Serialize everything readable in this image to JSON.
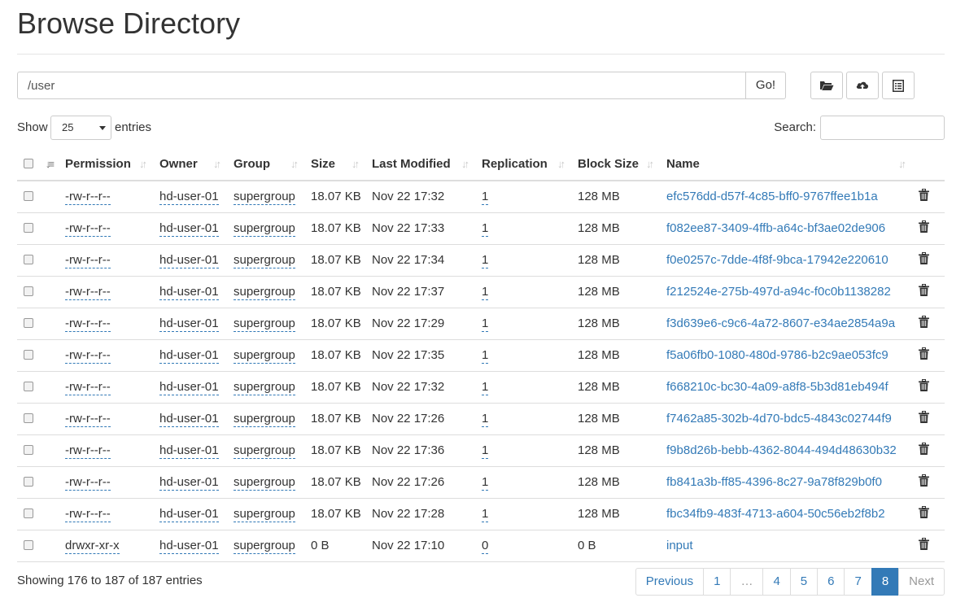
{
  "page_title": "Browse Directory",
  "path": {
    "value": "/user",
    "go_label": "Go!"
  },
  "toolbar": {
    "icons": [
      "folder-open-icon",
      "upload-cloud-icon",
      "list-icon"
    ]
  },
  "controls": {
    "show_label": "Show",
    "entries_value": "25",
    "entries_label": "entries",
    "search_label": "Search:",
    "search_value": ""
  },
  "columns": [
    "Permission",
    "Owner",
    "Group",
    "Size",
    "Last Modified",
    "Replication",
    "Block Size",
    "Name"
  ],
  "rows": [
    {
      "permission": "-rw-r--r--",
      "owner": "hd-user-01",
      "group": "supergroup",
      "size": "18.07 KB",
      "modified": "Nov 22 17:32",
      "replication": "1",
      "block_size": "128 MB",
      "name": "efc576dd-d57f-4c85-bff0-9767ffee1b1a"
    },
    {
      "permission": "-rw-r--r--",
      "owner": "hd-user-01",
      "group": "supergroup",
      "size": "18.07 KB",
      "modified": "Nov 22 17:33",
      "replication": "1",
      "block_size": "128 MB",
      "name": "f082ee87-3409-4ffb-a64c-bf3ae02de906"
    },
    {
      "permission": "-rw-r--r--",
      "owner": "hd-user-01",
      "group": "supergroup",
      "size": "18.07 KB",
      "modified": "Nov 22 17:34",
      "replication": "1",
      "block_size": "128 MB",
      "name": "f0e0257c-7dde-4f8f-9bca-17942e220610"
    },
    {
      "permission": "-rw-r--r--",
      "owner": "hd-user-01",
      "group": "supergroup",
      "size": "18.07 KB",
      "modified": "Nov 22 17:37",
      "replication": "1",
      "block_size": "128 MB",
      "name": "f212524e-275b-497d-a94c-f0c0b1138282"
    },
    {
      "permission": "-rw-r--r--",
      "owner": "hd-user-01",
      "group": "supergroup",
      "size": "18.07 KB",
      "modified": "Nov 22 17:29",
      "replication": "1",
      "block_size": "128 MB",
      "name": "f3d639e6-c9c6-4a72-8607-e34ae2854a9a"
    },
    {
      "permission": "-rw-r--r--",
      "owner": "hd-user-01",
      "group": "supergroup",
      "size": "18.07 KB",
      "modified": "Nov 22 17:35",
      "replication": "1",
      "block_size": "128 MB",
      "name": "f5a06fb0-1080-480d-9786-b2c9ae053fc9"
    },
    {
      "permission": "-rw-r--r--",
      "owner": "hd-user-01",
      "group": "supergroup",
      "size": "18.07 KB",
      "modified": "Nov 22 17:32",
      "replication": "1",
      "block_size": "128 MB",
      "name": "f668210c-bc30-4a09-a8f8-5b3d81eb494f"
    },
    {
      "permission": "-rw-r--r--",
      "owner": "hd-user-01",
      "group": "supergroup",
      "size": "18.07 KB",
      "modified": "Nov 22 17:26",
      "replication": "1",
      "block_size": "128 MB",
      "name": "f7462a85-302b-4d70-bdc5-4843c02744f9"
    },
    {
      "permission": "-rw-r--r--",
      "owner": "hd-user-01",
      "group": "supergroup",
      "size": "18.07 KB",
      "modified": "Nov 22 17:36",
      "replication": "1",
      "block_size": "128 MB",
      "name": "f9b8d26b-bebb-4362-8044-494d48630b32"
    },
    {
      "permission": "-rw-r--r--",
      "owner": "hd-user-01",
      "group": "supergroup",
      "size": "18.07 KB",
      "modified": "Nov 22 17:26",
      "replication": "1",
      "block_size": "128 MB",
      "name": "fb841a3b-ff85-4396-8c27-9a78f829b0f0"
    },
    {
      "permission": "-rw-r--r--",
      "owner": "hd-user-01",
      "group": "supergroup",
      "size": "18.07 KB",
      "modified": "Nov 22 17:28",
      "replication": "1",
      "block_size": "128 MB",
      "name": "fbc34fb9-483f-4713-a604-50c56eb2f8b2"
    },
    {
      "permission": "drwxr-xr-x",
      "owner": "hd-user-01",
      "group": "supergroup",
      "size": "0 B",
      "modified": "Nov 22 17:10",
      "replication": "0",
      "block_size": "0 B",
      "name": "input"
    }
  ],
  "footer": {
    "info": "Showing 176 to 187 of 187 entries"
  },
  "pagination": {
    "items": [
      {
        "label": "Previous",
        "state": "normal"
      },
      {
        "label": "1",
        "state": "normal"
      },
      {
        "label": "…",
        "state": "ellipsis"
      },
      {
        "label": "4",
        "state": "normal"
      },
      {
        "label": "5",
        "state": "normal"
      },
      {
        "label": "6",
        "state": "normal"
      },
      {
        "label": "7",
        "state": "normal"
      },
      {
        "label": "8",
        "state": "active"
      },
      {
        "label": "Next",
        "state": "disabled"
      }
    ]
  },
  "colors": {
    "link": "#337ab7",
    "active_page": "#337ab7",
    "border": "#dddddd"
  }
}
